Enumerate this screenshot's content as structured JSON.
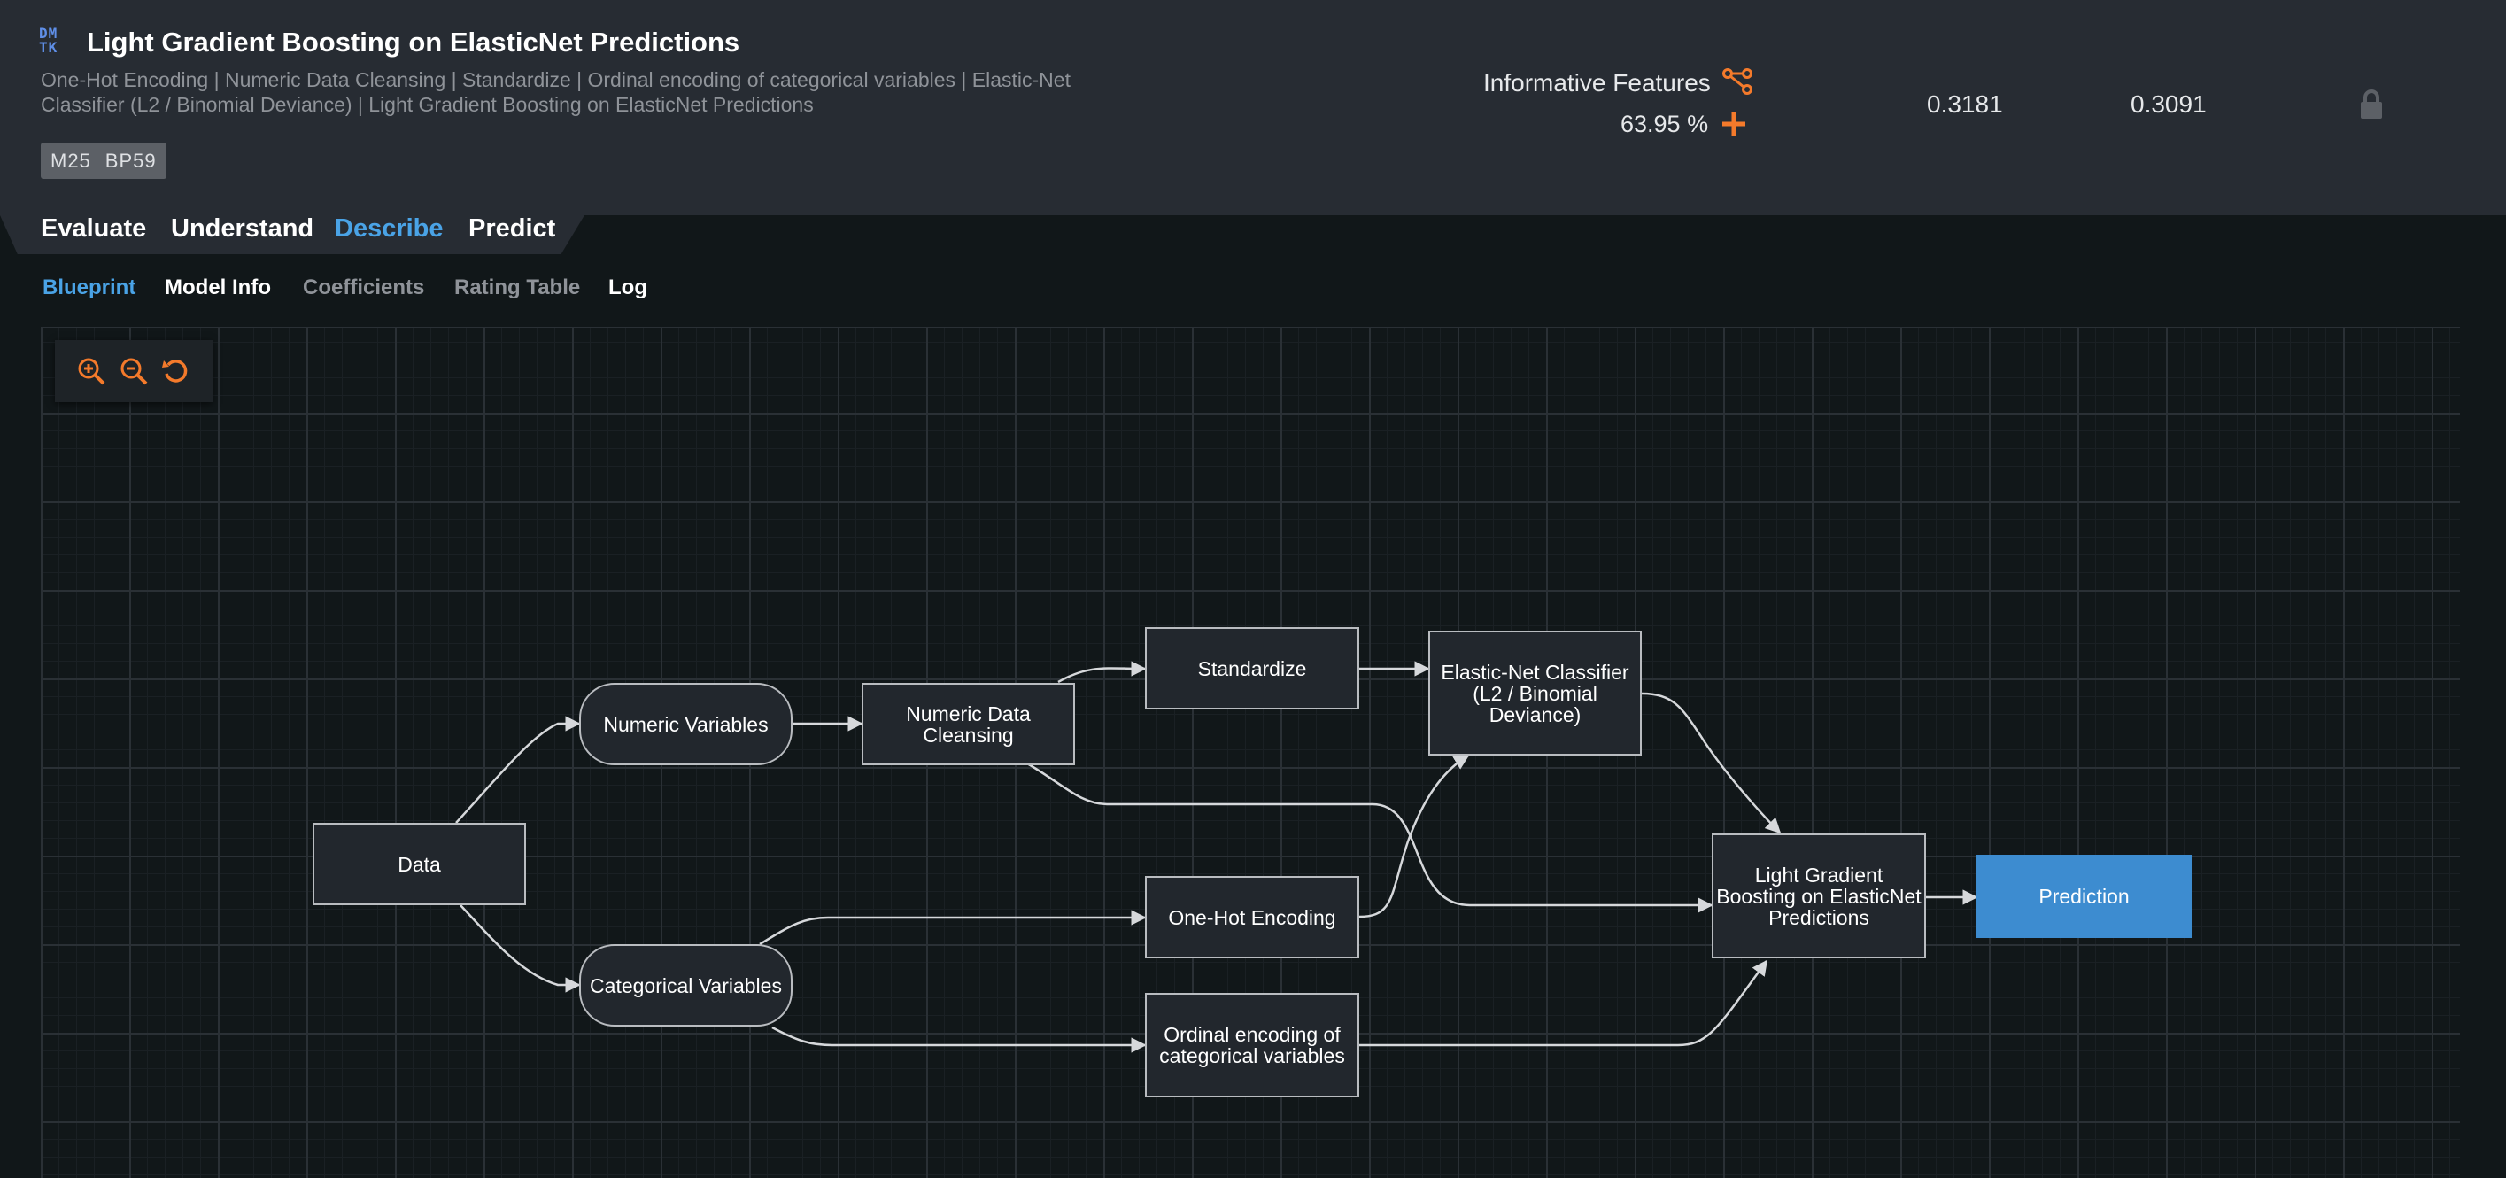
{
  "header": {
    "logo_text_top": "DM",
    "logo_text_bottom": "TK",
    "title": "Light Gradient Boosting on ElasticNet Predictions",
    "description": "One-Hot Encoding | Numeric Data Cleansing | Standardize | Ordinal encoding of categorical variables | Elastic-Net Classifier (L2 / Binomial Deviance) | Light Gradient Boosting on ElasticNet Predictions",
    "badge_model": "M25",
    "badge_blueprint": "BP59",
    "informative_features_label": "Informative Features",
    "feature_percent": "63.95 %",
    "metric_1": "0.3181",
    "metric_2": "0.3091",
    "accent_color": "#f47a2b"
  },
  "main_tabs": [
    {
      "label": "Evaluate",
      "active": false
    },
    {
      "label": "Understand",
      "active": false
    },
    {
      "label": "Describe",
      "active": true
    },
    {
      "label": "Predict",
      "active": false
    }
  ],
  "sub_tabs": [
    {
      "label": "Blueprint",
      "active": true,
      "color": "#4aa3e6"
    },
    {
      "label": "Model Info",
      "active": false,
      "color": "#ffffff"
    },
    {
      "label": "Coefficients",
      "active": false,
      "color": "#8f9399"
    },
    {
      "label": "Rating Table",
      "active": false,
      "color": "#8f9399"
    },
    {
      "label": "Log",
      "active": false,
      "color": "#ffffff"
    }
  ],
  "zoom_controls": {
    "zoom_in": "zoom-in-icon",
    "zoom_out": "zoom-out-icon",
    "reset": "reset-icon"
  },
  "blueprint": {
    "nodes": {
      "data": "Data",
      "numeric_variables": "Numeric Variables",
      "categorical_variables": "Categorical Variables",
      "numeric_data_cleansing": "Numeric Data Cleansing",
      "standardize": "Standardize",
      "one_hot_encoding": "One-Hot Encoding",
      "ordinal_encoding": "Ordinal encoding of categorical variables",
      "elastic_net": "Elastic-Net Classifier (L2 / Binomial Deviance)",
      "lgbm": "Light Gradient Boosting on ElasticNet Predictions",
      "prediction": "Prediction"
    },
    "edges": [
      [
        "data",
        "numeric_variables"
      ],
      [
        "data",
        "categorical_variables"
      ],
      [
        "numeric_variables",
        "numeric_data_cleansing"
      ],
      [
        "numeric_data_cleansing",
        "standardize"
      ],
      [
        "numeric_data_cleansing",
        "lgbm"
      ],
      [
        "standardize",
        "elastic_net"
      ],
      [
        "categorical_variables",
        "one_hot_encoding"
      ],
      [
        "categorical_variables",
        "ordinal_encoding"
      ],
      [
        "one_hot_encoding",
        "elastic_net"
      ],
      [
        "elastic_net",
        "lgbm"
      ],
      [
        "ordinal_encoding",
        "lgbm"
      ],
      [
        "lgbm",
        "prediction"
      ]
    ]
  }
}
